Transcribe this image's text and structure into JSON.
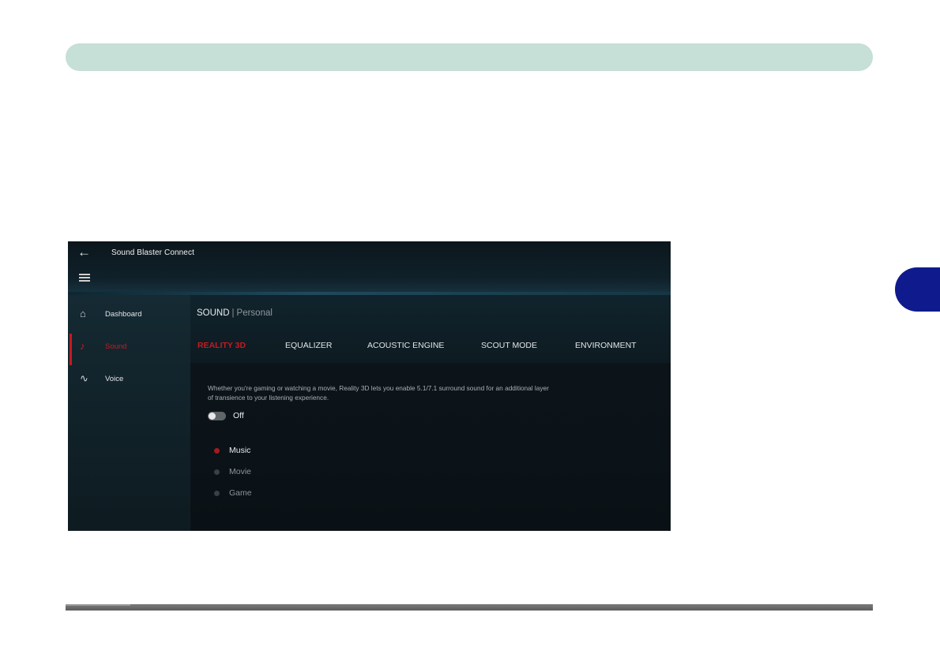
{
  "app": {
    "title": "Sound Blaster Connect",
    "back_icon": "arrow-left-icon",
    "menu_icon": "hamburger-icon"
  },
  "sidebar": {
    "items": [
      {
        "label": "Dashboard",
        "icon": "home-icon",
        "active": false
      },
      {
        "label": "Sound",
        "icon": "music-note-icon",
        "active": true
      },
      {
        "label": "Voice",
        "icon": "voice-wave-icon",
        "active": false
      }
    ]
  },
  "header": {
    "section": "SOUND",
    "separator": "|",
    "profile": "Personal"
  },
  "tabs": [
    {
      "label": "REALITY 3D",
      "active": true
    },
    {
      "label": "EQUALIZER",
      "active": false
    },
    {
      "label": "ACOUSTIC ENGINE",
      "active": false
    },
    {
      "label": "SCOUT MODE",
      "active": false
    },
    {
      "label": "ENVIRONMENT",
      "active": false
    }
  ],
  "reality3d": {
    "description": "Whether you're gaming or watching a movie, Reality 3D lets you enable 5.1/7.1 surround sound for an additional layer of transience to your listening experience.",
    "toggle_state": "Off",
    "modes": [
      {
        "label": "Music",
        "selected": true
      },
      {
        "label": "Movie",
        "selected": false
      },
      {
        "label": "Game",
        "selected": false
      }
    ]
  },
  "colors": {
    "accent_red": "#c41b20",
    "header_bar": "#c6dfd7",
    "chapter_tab": "#0f1a8c"
  }
}
